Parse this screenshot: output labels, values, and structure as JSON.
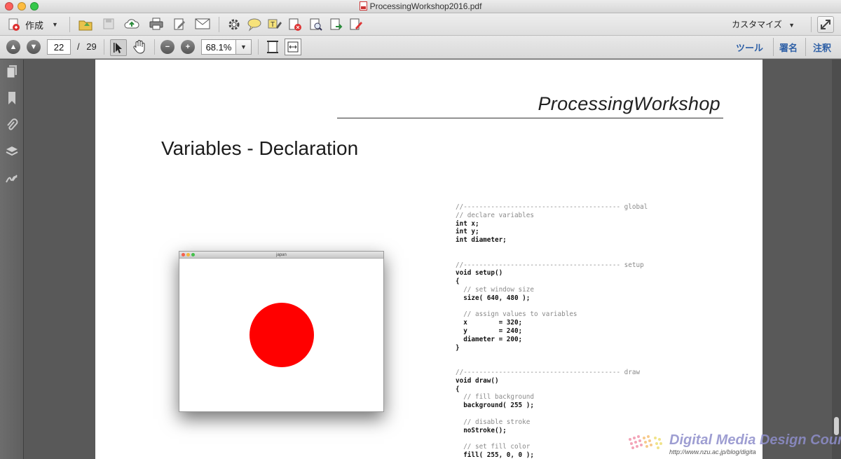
{
  "window": {
    "title": "ProcessingWorkshop2016.pdf"
  },
  "toolbar": {
    "create_label": "作成",
    "customize_label": "カスタマイズ",
    "page_current": "22",
    "page_separator": "/",
    "page_total": "29",
    "zoom_value": "68.1%",
    "tabs": {
      "tools": "ツール",
      "sign": "署名",
      "comment": "注釈"
    }
  },
  "colors": {
    "accent_link": "#2d5fa6",
    "circle_fill": "#ff0000",
    "code_comment": "#8a8a8a"
  },
  "document": {
    "header_title": "ProcessingWorkshop",
    "slide_title": "Variables - Declaration",
    "sketch_window_title": "japan",
    "code_lines": [
      {
        "text": "//---------------------------------------- global",
        "kind": "c"
      },
      {
        "text": "// declare variables",
        "kind": "c"
      },
      {
        "text": "int x;",
        "kind": "k"
      },
      {
        "text": "int y;",
        "kind": "k"
      },
      {
        "text": "int diameter;",
        "kind": "k"
      },
      {
        "text": "",
        "kind": "k"
      },
      {
        "text": "",
        "kind": "k"
      },
      {
        "text": "//---------------------------------------- setup",
        "kind": "c"
      },
      {
        "text": "void setup()",
        "kind": "k"
      },
      {
        "text": "{",
        "kind": "k"
      },
      {
        "text": "  // set window size",
        "kind": "c"
      },
      {
        "text": "  size( 640, 480 );",
        "kind": "k"
      },
      {
        "text": "",
        "kind": "k"
      },
      {
        "text": "  // assign values to variables",
        "kind": "c"
      },
      {
        "text": "  x        = 320;",
        "kind": "k"
      },
      {
        "text": "  y        = 240;",
        "kind": "k"
      },
      {
        "text": "  diameter = 200;",
        "kind": "k"
      },
      {
        "text": "}",
        "kind": "k"
      },
      {
        "text": "",
        "kind": "k"
      },
      {
        "text": "",
        "kind": "k"
      },
      {
        "text": "//---------------------------------------- draw",
        "kind": "c"
      },
      {
        "text": "void draw()",
        "kind": "k"
      },
      {
        "text": "{",
        "kind": "k"
      },
      {
        "text": "  // fill background",
        "kind": "c"
      },
      {
        "text": "  background( 255 );",
        "kind": "k"
      },
      {
        "text": "",
        "kind": "k"
      },
      {
        "text": "  // disable stroke",
        "kind": "c"
      },
      {
        "text": "  noStroke();",
        "kind": "k"
      },
      {
        "text": "",
        "kind": "k"
      },
      {
        "text": "  // set fill color",
        "kind": "c"
      },
      {
        "text": "  fill( 255, 0, 0 );",
        "kind": "k"
      }
    ]
  },
  "watermark": {
    "title": "Digital Media Design Course",
    "url": "http://www.nzu.ac.jp/blog/digita"
  }
}
